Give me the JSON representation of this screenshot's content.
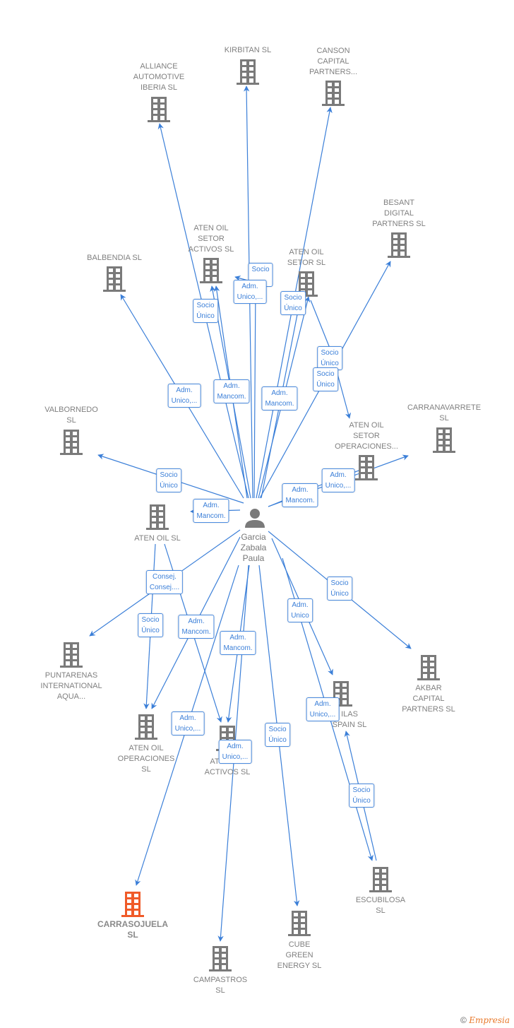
{
  "colors": {
    "edge": "#3b7fd8",
    "node": "#7a7a7a",
    "highlight": "#f05a28",
    "label": "#808080"
  },
  "person": {
    "icon": "person-icon",
    "lines": [
      "Garcia",
      "Zabala",
      "Paula"
    ]
  },
  "nodes": [
    {
      "id": "kirbitan",
      "lines": [
        "KIRBITAN  SL"
      ]
    },
    {
      "id": "alliance",
      "lines": [
        "ALLIANCE",
        "AUTOMOTIVE",
        "IBERIA  SL"
      ]
    },
    {
      "id": "canson",
      "lines": [
        "CANSON",
        "CAPITAL",
        "PARTNERS..."
      ]
    },
    {
      "id": "besant",
      "lines": [
        "BESANT",
        "DIGITAL",
        "PARTNERS  SL"
      ]
    },
    {
      "id": "aten-setor-activos",
      "lines": [
        "ATEN OIL",
        "SETOR",
        "ACTIVOS  SL"
      ]
    },
    {
      "id": "aten-setor",
      "lines": [
        "ATEN OIL",
        "SETOR  SL"
      ]
    },
    {
      "id": "balbendia",
      "lines": [
        "BALBENDIA  SL"
      ]
    },
    {
      "id": "valbornedo",
      "lines": [
        "VALBORNEDO",
        "SL"
      ]
    },
    {
      "id": "carranavarrete",
      "lines": [
        "CARRANAVARRETE",
        "SL"
      ]
    },
    {
      "id": "aten-setor-operaciones",
      "lines": [
        "ATEN OIL",
        "SETOR",
        "OPERACIONES..."
      ]
    },
    {
      "id": "aten-oil",
      "lines": [
        "ATEN OIL  SL"
      ]
    },
    {
      "id": "puntarenas",
      "lines": [
        "PUNTARENAS",
        "INTERNATIONAL",
        "AQUA..."
      ]
    },
    {
      "id": "akbar",
      "lines": [
        "AKBAR",
        "CAPITAL",
        "PARTNERS  SL"
      ]
    },
    {
      "id": "aten-operaciones",
      "lines": [
        "ATEN OIL",
        "OPERACIONES",
        "SL"
      ]
    },
    {
      "id": "aten-activos",
      "lines": [
        "ATEN OIL",
        "ACTIVOS  SL"
      ]
    },
    {
      "id": "ilas-spain",
      "lines": [
        "ILAS",
        "SPAIN  SL"
      ]
    },
    {
      "id": "escubilosa",
      "lines": [
        "ESCUBILOSA",
        "SL"
      ]
    },
    {
      "id": "carrasojuela",
      "lines": [
        "CARRASOJUELA",
        "SL"
      ],
      "main": true
    },
    {
      "id": "cube-green",
      "lines": [
        "CUBE",
        "GREEN",
        "ENERGY  SL"
      ]
    },
    {
      "id": "campastros",
      "lines": [
        "CAMPASTROS",
        "SL"
      ]
    }
  ],
  "edge_labels": [
    [
      "Socio",
      ""
    ],
    [
      "Adm.",
      "Unico,..."
    ],
    [
      "Socio",
      "Único"
    ],
    [
      "Socio",
      "Único"
    ],
    [
      "Socio",
      "Único"
    ],
    [
      "Socio",
      "Único"
    ],
    [
      "Adm.",
      "Unico,..."
    ],
    [
      "Adm.",
      "Mancom."
    ],
    [
      "Adm.",
      "Mancom."
    ],
    [
      "Socio",
      "Único"
    ],
    [
      "Adm.",
      "Unico,..."
    ],
    [
      "Adm.",
      "Mancom."
    ],
    [
      "Adm.",
      "Mancom."
    ],
    [
      "Consej.",
      "Consej...."
    ],
    [
      "Socio",
      "Único"
    ],
    [
      "Adm.",
      "Unico"
    ],
    [
      "Socio",
      "Único"
    ],
    [
      "Adm.",
      "Mancom."
    ],
    [
      "Adm.",
      "Mancom."
    ],
    [
      "Adm.",
      "Unico,..."
    ],
    [
      "Adm.",
      "Unico,..."
    ],
    [
      "Socio",
      "Único"
    ],
    [
      "Adm.",
      "Unico,..."
    ],
    [
      "Adm.",
      "Unico,..."
    ],
    [
      "Socio",
      "Único"
    ]
  ],
  "footer": {
    "copyright": "©",
    "brand": "Empresia"
  }
}
